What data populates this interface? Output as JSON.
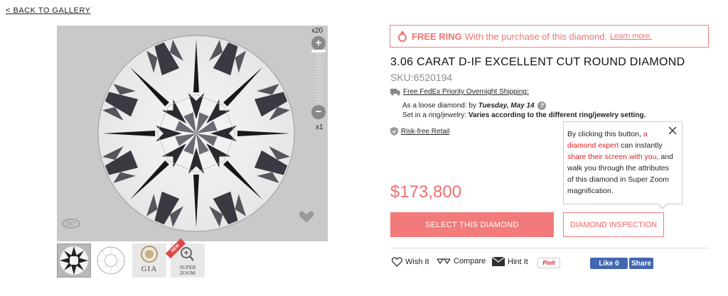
{
  "nav": {
    "back_label": "< BACK TO GALLERY"
  },
  "viewer": {
    "zoom_max_label": "x20",
    "zoom_min_label": "x1",
    "zoom_in_label": "+",
    "zoom_out_label": "−",
    "rotate_label": "360°",
    "thumbnails": [
      {
        "name": "diamond-photo",
        "icon": "diamond-thumb"
      },
      {
        "name": "diamond-outline",
        "icon": "diamond-outline-icon"
      },
      {
        "name": "gia-certificate",
        "label": "GIA",
        "icon": "gia-seal-icon"
      },
      {
        "name": "super-zoom",
        "label_1": "SUPER",
        "label_2": "ZOOM",
        "badge": "NEW",
        "icon": "magnifier-icon"
      }
    ]
  },
  "promo": {
    "icon": "ring-icon",
    "bold_text": "FREE RING",
    "text": "With the purchase of this diamond.",
    "link": "Learn more."
  },
  "product": {
    "title": "3.06 CARAT D-IF EXCELLENT CUT ROUND DIAMOND",
    "sku": "SKU:6520194",
    "price": "$173,800"
  },
  "shipping": {
    "heading": "Free FedEx Priority Overnight Shipping:",
    "loose_prefix": "As a loose diamond: by ",
    "loose_date": "Tuesday, May 14",
    "setting_prefix": "Set in a ring/jewelry: ",
    "setting_value": "Varies according to the different ring/jewelry setting."
  },
  "risk": {
    "label": "Risk-free Retail"
  },
  "buttons": {
    "select": "SELECT THIS DIAMOND",
    "inspection": "DIAMOND INSPECTION"
  },
  "tooltip": {
    "p1": "By clicking this button, ",
    "r1": "a diamond expert",
    "p2": " can instantly ",
    "r2": "share their screen with you",
    "p3": ", and walk you through the attributes of this diamond in Super Zoom magnification."
  },
  "actions": {
    "wish": "Wish It",
    "compare": "Compare",
    "hint": "Hint It",
    "pinit": "Pinit",
    "fb_like": "Like 0",
    "fb_share": "Share"
  },
  "colors": {
    "accent": "#f27a7a",
    "facebook": "#4267b2"
  }
}
